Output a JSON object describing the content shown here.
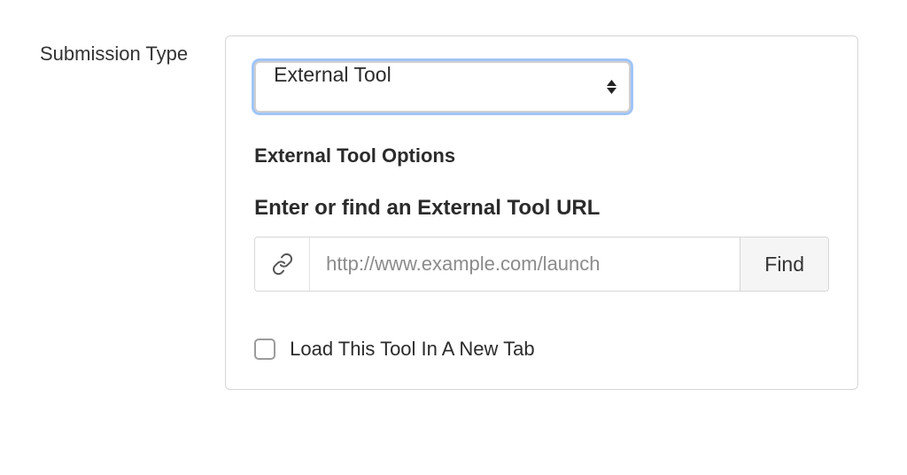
{
  "field_label": "Submission Type",
  "submission_type": {
    "selected": "External Tool"
  },
  "options_title": "External Tool Options",
  "url_section_title": "Enter or find an External Tool URL",
  "url_input": {
    "value": "",
    "placeholder": "http://www.example.com/launch"
  },
  "find_button_label": "Find",
  "new_tab_checkbox": {
    "label": "Load This Tool In A New Tab",
    "checked": false
  }
}
